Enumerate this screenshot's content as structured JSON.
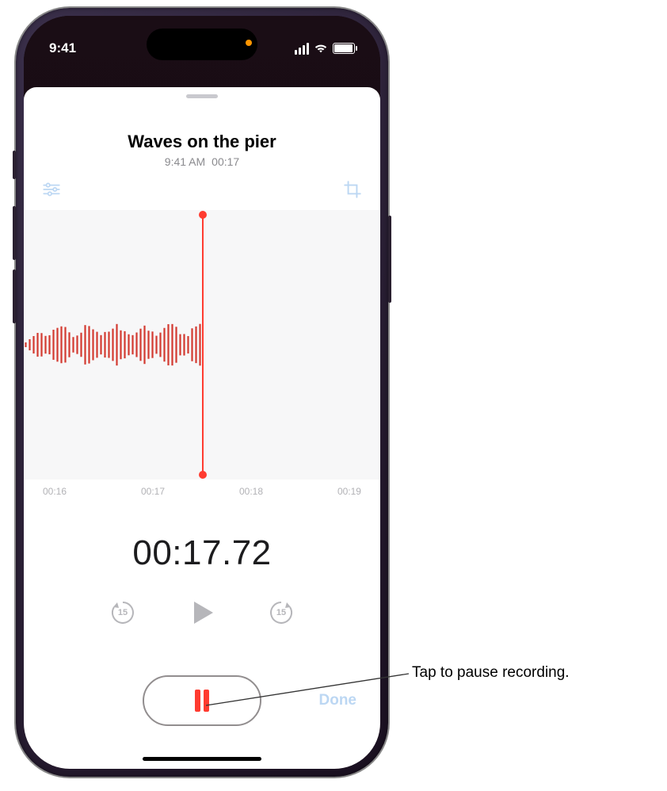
{
  "status": {
    "time": "9:41"
  },
  "recording": {
    "title": "Waves on the pier",
    "time_of_day": "9:41 AM",
    "duration_short": "00:17",
    "elapsed": "00:17.72"
  },
  "timeline": {
    "ticks": [
      "00:16",
      "00:17",
      "00:18",
      "00:19"
    ]
  },
  "controls": {
    "skip_seconds": "15",
    "done_label": "Done"
  },
  "callout": {
    "text": "Tap to pause recording."
  }
}
